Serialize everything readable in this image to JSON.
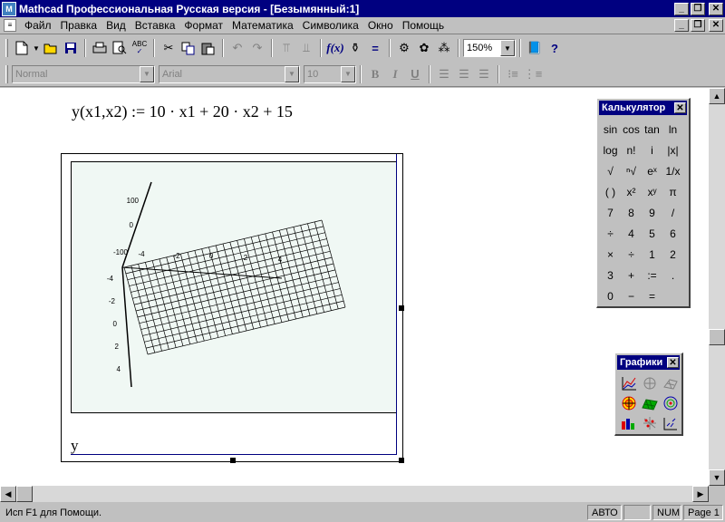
{
  "window": {
    "title": "Mathcad Профессиональная Русская версия - [Безымянный:1]",
    "controls": [
      "_",
      "❐",
      "✕"
    ]
  },
  "menu": [
    "Файл",
    "Правка",
    "Вид",
    "Вставка",
    "Формат",
    "Математика",
    "Символика",
    "Окно",
    "Помощь"
  ],
  "toolbar": {
    "zoom": "150%"
  },
  "format_bar": {
    "style": "Normal",
    "font": "Arial",
    "size": "10",
    "bold": "B",
    "italic": "I",
    "underline": "U"
  },
  "document": {
    "equation": "y(x1,x2) := 10 · x1 + 20 · x2 + 15",
    "plot_label": "y"
  },
  "chart_data": {
    "type": "surface-3d",
    "expression": "10·x1 + 20·x2 + 15",
    "z_ticks": [
      "100",
      "0",
      "-100"
    ],
    "y_ticks": [
      "-4",
      "-2",
      "0",
      "2",
      "4"
    ],
    "x_ticks": [
      "-4",
      "-2",
      "0",
      "2",
      "4"
    ],
    "grid": "wireframe"
  },
  "calculator": {
    "title": "Калькулятор",
    "keys": [
      "sin",
      "cos",
      "tan",
      "ln",
      "log",
      "n!",
      "i",
      "|x|",
      "√",
      "ⁿ√",
      "eˣ",
      "1/x",
      "( )",
      "x²",
      "xʸ",
      "π",
      "7",
      "8",
      "9",
      "/",
      "÷",
      "4",
      "5",
      "6",
      "×",
      "÷",
      "1",
      "2",
      "3",
      "+",
      ":=",
      ".",
      "0",
      "−",
      "="
    ]
  },
  "graphs": {
    "title": "Графики",
    "icons": [
      "xy-plot-icon",
      "polar-plot-icon",
      "surface-plot-icon",
      "contour-plot-icon",
      "3d-bar-plot-icon",
      "scatter-3d-plot-icon",
      "vector-field-plot-icon",
      "bar-chart-icon",
      "scatter-plot-icon"
    ]
  },
  "status": {
    "help": "Исп F1 для Помощи.",
    "mode": "АВТО",
    "blank": "",
    "num": "NUM",
    "page": "Page 1"
  }
}
